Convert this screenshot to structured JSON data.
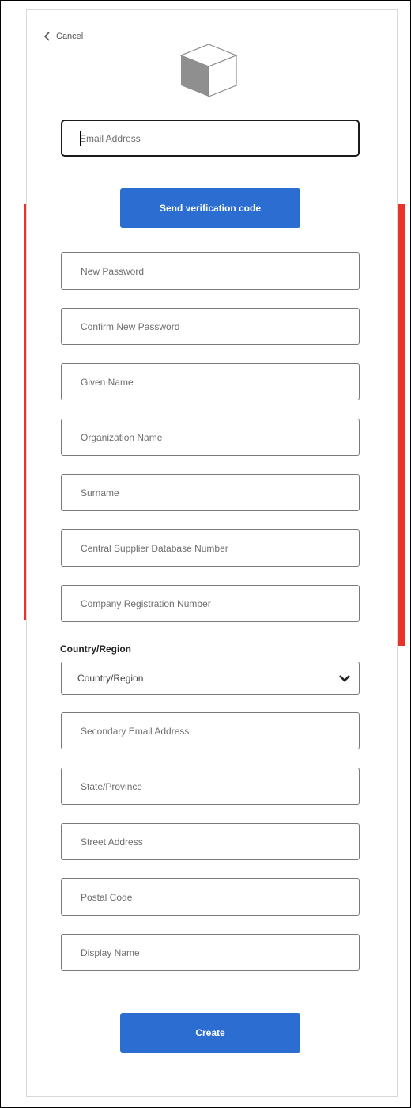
{
  "header": {
    "cancel_label": "Cancel"
  },
  "email": {
    "placeholder": "Email Address"
  },
  "verify_button": {
    "label": "Send verification code"
  },
  "fields": {
    "new_password": "New Password",
    "confirm_password": "Confirm New Password",
    "given_name": "Given Name",
    "organization_name": "Organization Name",
    "surname": "Surname",
    "csd_number": "Central Supplier Database Number",
    "company_registration": "Company Registration Number",
    "secondary_email": "Secondary Email Address",
    "state_province": "State/Province",
    "street_address": "Street Address",
    "postal_code": "Postal Code",
    "display_name": "Display Name"
  },
  "country": {
    "label": "Country/Region",
    "selected": "Country/Region"
  },
  "create_button": {
    "label": "Create"
  },
  "icons": {
    "back": "chevron-left-icon",
    "logo": "cube-icon",
    "dropdown": "chevron-down-icon"
  },
  "colors": {
    "primary": "#2b6dd1",
    "annotation": "#e8332a",
    "border": "#7a7a7a"
  }
}
